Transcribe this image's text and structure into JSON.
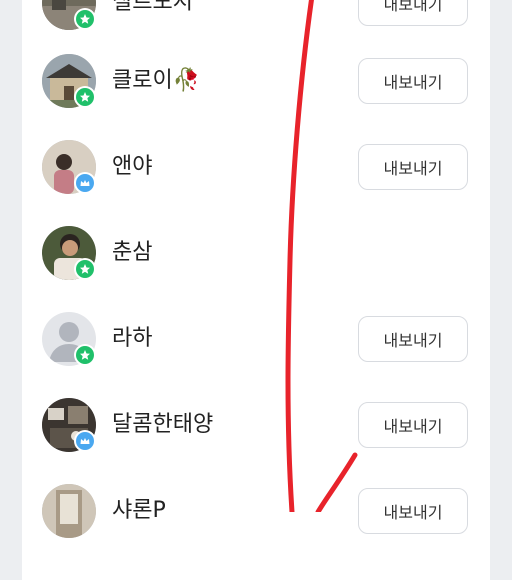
{
  "contacts": [
    {
      "name": "칠르도시",
      "badge": "green",
      "export_label": "내보내기",
      "avatar": "photo-street"
    },
    {
      "name": "클로이🥀",
      "badge": "green",
      "export_label": "내보내기",
      "avatar": "photo-house"
    },
    {
      "name": "앤야",
      "badge": "blue",
      "export_label": "내보내기",
      "avatar": "photo-person"
    },
    {
      "name": "춘삼",
      "badge": "green",
      "export_label": "",
      "avatar": "photo-man"
    },
    {
      "name": "라하",
      "badge": "green",
      "export_label": "내보내기",
      "avatar": "default-silhouette"
    },
    {
      "name": "달콤한태양",
      "badge": "blue",
      "export_label": "내보내기",
      "avatar": "photo-room"
    },
    {
      "name": "샤론P",
      "badge": "none",
      "export_label": "내보내기",
      "avatar": "photo-door"
    }
  ],
  "colors": {
    "accent_green": "#20c06a",
    "accent_blue": "#4aa8f0",
    "annotation_red": "#e8232b"
  },
  "badge_icons": {
    "green": "star-icon",
    "blue": "crown-icon"
  }
}
